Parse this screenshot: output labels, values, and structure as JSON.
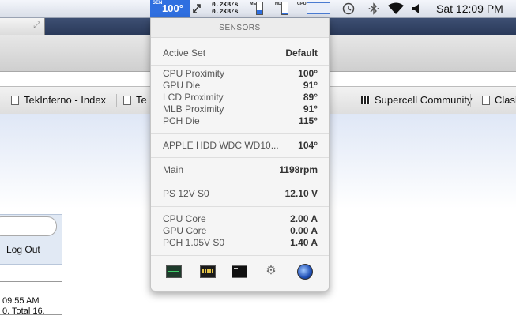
{
  "menubar": {
    "sensor_badge_label": "SEN",
    "sensor_temp": "100°",
    "net_up": "0.2KB/s",
    "net_down": "0.2KB/s",
    "mem_label": "MEM",
    "mem_fill": 0.35,
    "hdd_label": "HDD",
    "hdd_fill": 0.08,
    "cpu_label": "CPU",
    "cpu_fill": 0.05,
    "clock": "Sat 12:09 PM",
    "icons": [
      "resize-arrows-icon",
      "time-machine-icon",
      "bluetooth-icon",
      "wifi-icon",
      "volume-icon"
    ]
  },
  "browser": {
    "bookmarks": [
      {
        "label": "TekInferno - Index",
        "icon": "doc-icon"
      },
      {
        "label": "Te",
        "icon": "doc-icon"
      },
      {
        "label": "Supercell Community",
        "icon": "grid-icon"
      },
      {
        "label": "Clash",
        "icon": "doc-icon"
      }
    ],
    "logout_label": "Log Out",
    "timestamp": "09:55 AM",
    "total_text": "0. Total 16."
  },
  "sensors_menu": {
    "header": "SENSORS",
    "active_set": {
      "label": "Active Set",
      "value": "Default"
    },
    "temps": [
      {
        "label": "CPU Proximity",
        "value": "100°"
      },
      {
        "label": "GPU Die",
        "value": "91°"
      },
      {
        "label": "LCD Proximity",
        "value": "89°"
      },
      {
        "label": "MLB Proximity",
        "value": "91°"
      },
      {
        "label": "PCH Die",
        "value": "115°"
      }
    ],
    "disk": {
      "label": "APPLE HDD WDC WD10...",
      "value": "104°"
    },
    "fan": {
      "label": "Main",
      "value": "1198rpm"
    },
    "voltage": {
      "label": "PS 12V S0",
      "value": "12.10 V"
    },
    "currents": [
      {
        "label": "CPU Core",
        "value": "2.00 A"
      },
      {
        "label": "GPU Core",
        "value": "0.00 A"
      },
      {
        "label": "PCH 1.05V S0",
        "value": "1.40 A"
      }
    ],
    "tools": [
      "activity-monitor-icon",
      "console-icon",
      "terminal-icon",
      "system-utility-icon",
      "network-utility-icon"
    ]
  }
}
